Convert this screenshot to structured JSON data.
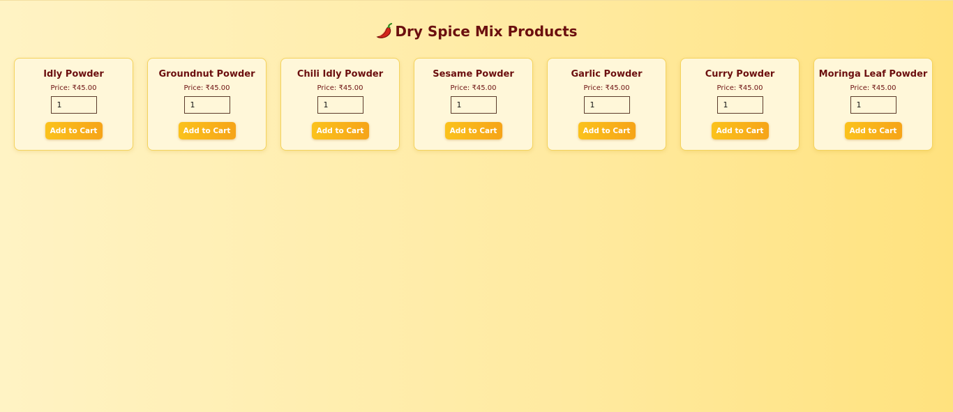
{
  "page": {
    "title": "Dry Spice Mix Products",
    "title_icon": "chili-pepper-icon"
  },
  "colors": {
    "title": "#6b0f0f",
    "card_bg": "#fff7d9",
    "card_border": "#f4d35e",
    "button_start": "#fbc21c",
    "button_end": "#f6a418"
  },
  "labels": {
    "price_prefix": "Price: ",
    "add_to_cart": "Add to Cart"
  },
  "products": [
    {
      "name": "Idly Powder",
      "price": "₹45.00",
      "quantity": "1"
    },
    {
      "name": "Groundnut Powder",
      "price": "₹45.00",
      "quantity": "1"
    },
    {
      "name": "Chili Idly Powder",
      "price": "₹45.00",
      "quantity": "1"
    },
    {
      "name": "Sesame Powder",
      "price": "₹45.00",
      "quantity": "1"
    },
    {
      "name": "Garlic Powder",
      "price": "₹45.00",
      "quantity": "1"
    },
    {
      "name": "Curry Powder",
      "price": "₹45.00",
      "quantity": "1"
    },
    {
      "name": "Moringa Leaf Powder",
      "price": "₹45.00",
      "quantity": "1"
    }
  ]
}
